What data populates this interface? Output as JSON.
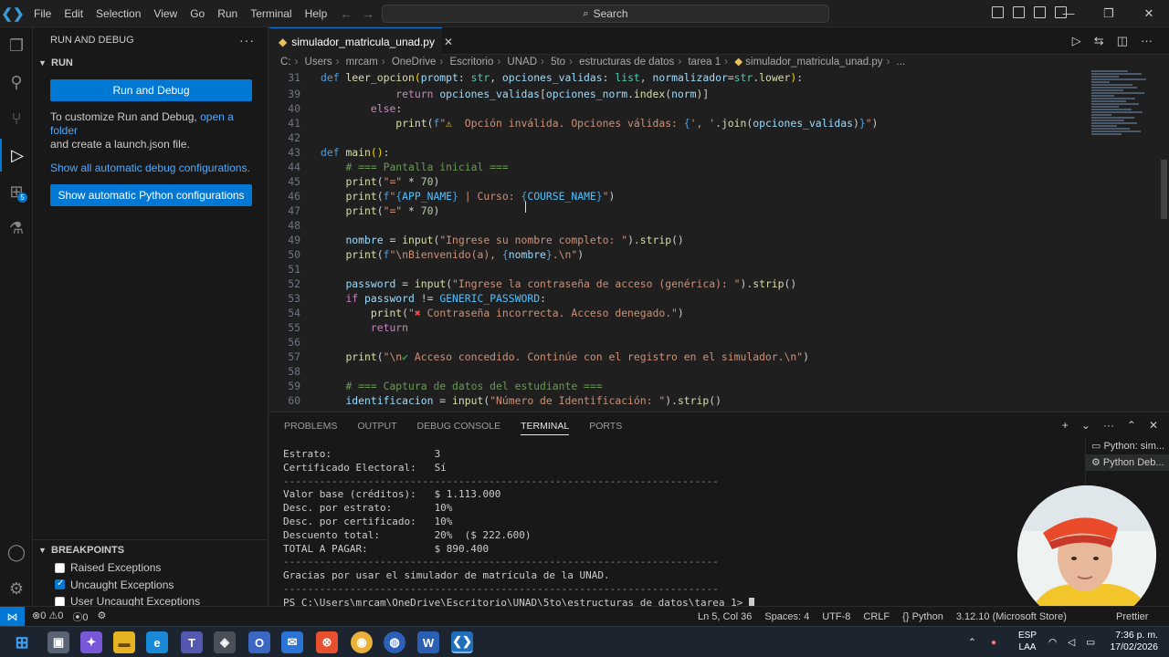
{
  "menu": [
    "File",
    "Edit",
    "Selection",
    "View",
    "Go",
    "Run",
    "Terminal",
    "Help"
  ],
  "search": {
    "label": "Search"
  },
  "sidebar": {
    "title": "RUN AND DEBUG",
    "section": "RUN",
    "run_button": "Run and Debug",
    "customize_text_1": "To customize Run and Debug, ",
    "customize_link": "open a folder",
    "customize_text_2": "and create a launch.json file.",
    "show_configs_link": "Show all automatic debug configurations.",
    "python_configs_button": "Show automatic Python configurations",
    "breakpoints": {
      "title": "BREAKPOINTS",
      "items": [
        {
          "label": "Raised Exceptions",
          "checked": false
        },
        {
          "label": "Uncaught Exceptions",
          "checked": true
        },
        {
          "label": "User Uncaught Exceptions",
          "checked": false
        }
      ]
    }
  },
  "editor": {
    "tab_label": "simulador_matricula_unad.py",
    "breadcrumb": [
      "C:",
      "Users",
      "mrcam",
      "OneDrive",
      "Escritorio",
      "UNAD",
      "5to",
      "estructuras de datos",
      "tarea 1",
      "simulador_matricula_unad.py",
      "..."
    ],
    "line_numbers": [
      "31",
      "39",
      "40",
      "41",
      "42",
      "43",
      "44",
      "45",
      "46",
      "47",
      "48",
      "49",
      "50",
      "51",
      "52",
      "53",
      "54",
      "55",
      "56",
      "57",
      "58",
      "59",
      "60"
    ]
  },
  "panel": {
    "tabs": [
      "PROBLEMS",
      "OUTPUT",
      "DEBUG CONSOLE",
      "TERMINAL",
      "PORTS"
    ],
    "active_tab": "TERMINAL",
    "terminal_lines": [
      "Estrato:                 3",
      "Certificado Electoral:   Sí",
      "------------------------------------------------------------------------",
      "Valor base (créditos):   $ 1.113.000",
      "Desc. por estrato:       10%",
      "Desc. por certificado:   10%",
      "Descuento total:         20%  ($ 222.600)",
      "TOTAL A PAGAR:           $ 890.400",
      "------------------------------------------------------------------------",
      "Gracias por usar el simulador de matrícula de la UNAD.",
      "------------------------------------------------------------------------",
      "PS C:\\Users\\mrcam\\OneDrive\\Escritorio\\UNAD\\5to\\estructuras de datos\\tarea 1> "
    ],
    "terminal_list": [
      "Python: sim...",
      "Python Deb..."
    ]
  },
  "statusbar": {
    "errors": "0",
    "warnings": "0",
    "ports": "0",
    "position": "Ln 5, Col 36",
    "spaces": "Spaces: 4",
    "encoding": "UTF-8",
    "eol": "CRLF",
    "language": "Python",
    "interpreter": "3.12.10 (Microsoft Store)",
    "prettier": "Prettier"
  },
  "taskbar": {
    "lang_1": "ESP",
    "lang_2": "LAA",
    "time": "7:36 p. m.",
    "date": "17/02/2026"
  },
  "colors": {
    "accent": "#0078d4",
    "background": "#1f1f1f",
    "sidebar": "#181818"
  }
}
